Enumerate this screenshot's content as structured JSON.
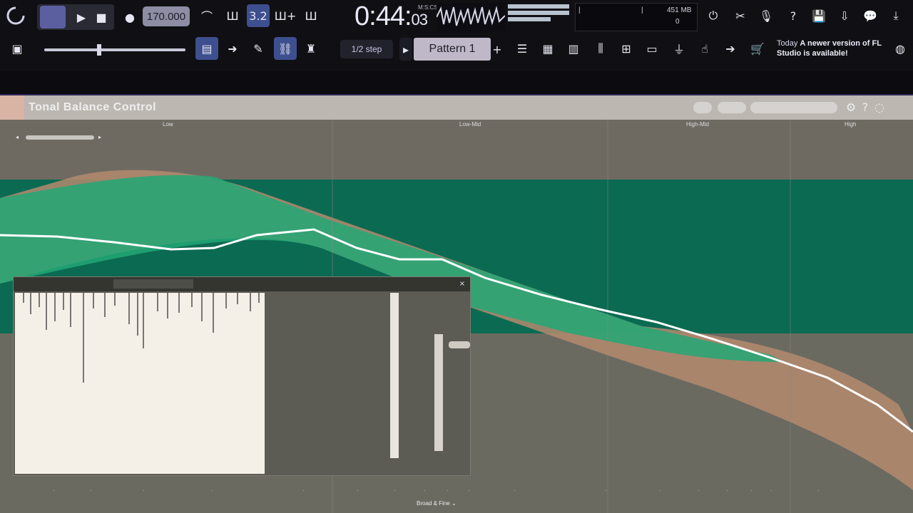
{
  "toolbar": {
    "bpm": "170.000",
    "clock_main": "0:44:",
    "clock_sub": "03",
    "clock_unit": "M:S:CS",
    "cpu_top": "451 MB",
    "cpu_poly": "0",
    "snap_label": "1/2 step",
    "pattern_label": "Pattern 1",
    "news_today": "Today",
    "news_text": "A newer version of FL Studio is available!",
    "tool_icons_row1": [
      "record-icon",
      "pattern-song-toggle",
      "play-icon",
      "stop-icon",
      "metronome-icon"
    ],
    "tool_icons_row2": [
      "multilink-icon",
      "arrow-icon",
      "pencil-icon",
      "link-icon",
      "stamp-icon"
    ],
    "right_icons": [
      "power-icon",
      "scissors-icon",
      "microphone-icon",
      "help-icon",
      "save-icon",
      "render-icon",
      "chat-icon",
      "download-icon"
    ],
    "window_icons": [
      "playlist-icon",
      "piano-roll-icon",
      "channel-rack-icon",
      "mixer-icon",
      "browser-icon",
      "plugin-icon",
      "plug-icon",
      "touch-icon",
      "arrow-right-icon",
      "cart-icon"
    ]
  },
  "plugin": {
    "title": "Tonal Balance Control",
    "bands": [
      "Low",
      "Low-Mid",
      "High-Mid",
      "High"
    ],
    "bottom_label": "Broad & Fine"
  },
  "colors": {
    "accent": "#3d4f8e",
    "band_teal": "#0b6a52",
    "range_green": "#23a776",
    "range_brown": "#b48a6e",
    "curve": "#ffffff"
  }
}
